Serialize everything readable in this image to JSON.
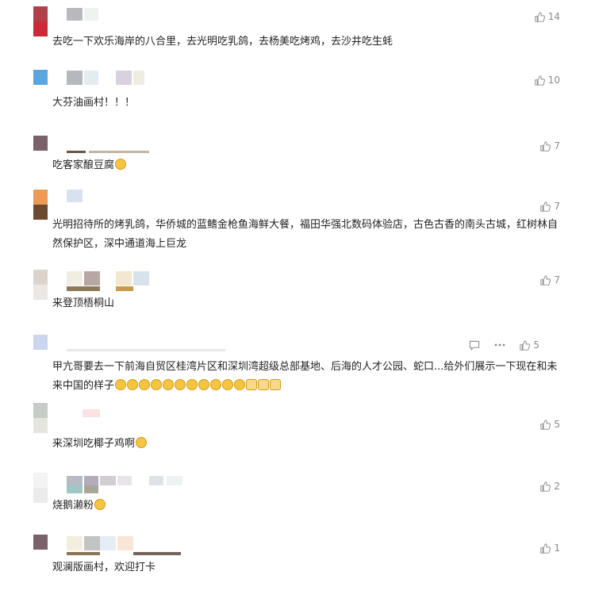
{
  "comments": [
    {
      "text": "去吃一下欢乐海岸的八合里，去光明吃乳鸽，去杨美吃烤鸡，去沙井吃生蚝",
      "likes": "14"
    },
    {
      "text": "大芬油画村！！！",
      "likes": "10"
    },
    {
      "text": "吃客家酿豆腐",
      "likes": "7",
      "emoji": [
        "grin"
      ]
    },
    {
      "text": "光明招待所的烤乳鸽，华侨城的蓝鳍金枪鱼海鲜大餐，福田华强北数码体验店，古色古香的南头古城，红树林自然保护区，深中通道海上巨龙",
      "likes": "7"
    },
    {
      "text": "来登顶梧桐山",
      "likes": "7"
    },
    {
      "text": "甲亢哥要去一下前海自贸区桂湾片区和深圳湾超级总部基地、后海的人才公园、蛇口...给外们展示一下现在和未来中国的样子",
      "likes": "5",
      "has_actions": true,
      "emoji": [
        "wink",
        "wink",
        "grin",
        "grin",
        "grin",
        "grin",
        "thinking",
        "thinking",
        "kiss",
        "kiss",
        "kiss",
        "cat",
        "cat",
        "cat"
      ]
    },
    {
      "text": "来深圳吃椰子鸡啊",
      "likes": "5",
      "emoji": [
        "thinking"
      ]
    },
    {
      "text": "烧鹅濑粉",
      "likes": "2",
      "emoji": [
        "heart-eyes"
      ]
    },
    {
      "text": "观澜版画村，欢迎打卡",
      "likes": "1"
    }
  ],
  "icons": {
    "like": "thumbs-up-icon",
    "reply": "comment-icon",
    "more": "more-dots-icon"
  },
  "colors": {
    "text": "#222222",
    "meta": "#8a8a8a"
  }
}
